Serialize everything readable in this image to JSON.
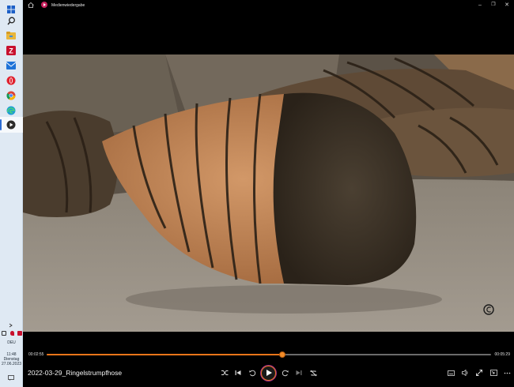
{
  "taskbar": {
    "clock_time": "11:48",
    "clock_day": "Dienstag",
    "clock_date": "27.06.2023",
    "language": "DEU"
  },
  "window": {
    "title": "Medienwiedergabe"
  },
  "player": {
    "elapsed": "00:02:55",
    "duration": "00:05:29",
    "progress": 0.53,
    "media_title": "2022-03-29_Ringelstrumpfhose"
  },
  "colors": {
    "accent": "#e8751a",
    "taskbar_bg": "#dfe9f3"
  }
}
